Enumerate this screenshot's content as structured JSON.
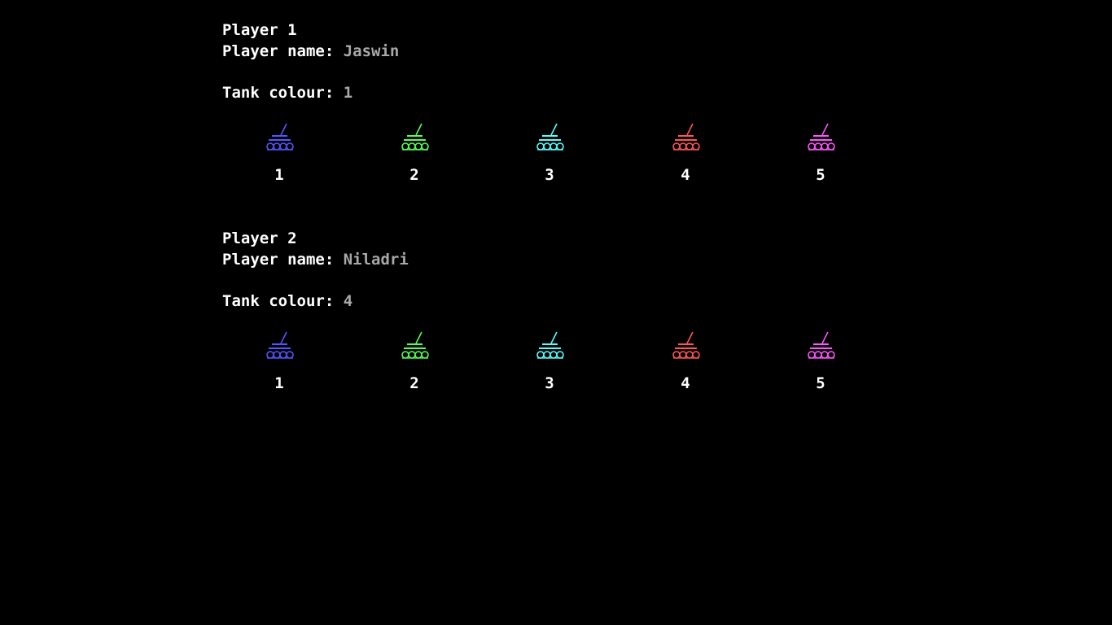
{
  "players": [
    {
      "title": "Player 1",
      "name_label": "Player name: ",
      "name_value": "Jaswin",
      "colour_label": "Tank colour: ",
      "colour_value": "1",
      "tanks": [
        {
          "number": "1",
          "color": "#5555ff"
        },
        {
          "number": "2",
          "color": "#55ff55"
        },
        {
          "number": "3",
          "color": "#55ffff"
        },
        {
          "number": "4",
          "color": "#ff5555"
        },
        {
          "number": "5",
          "color": "#ff55ff"
        }
      ]
    },
    {
      "title": "Player 2",
      "name_label": "Player name: ",
      "name_value": "Niladri",
      "colour_label": "Tank colour: ",
      "colour_value": "4",
      "tanks": [
        {
          "number": "1",
          "color": "#5555ff"
        },
        {
          "number": "2",
          "color": "#55ff55"
        },
        {
          "number": "3",
          "color": "#55ffff"
        },
        {
          "number": "4",
          "color": "#ff5555"
        },
        {
          "number": "5",
          "color": "#ff55ff"
        }
      ]
    }
  ]
}
